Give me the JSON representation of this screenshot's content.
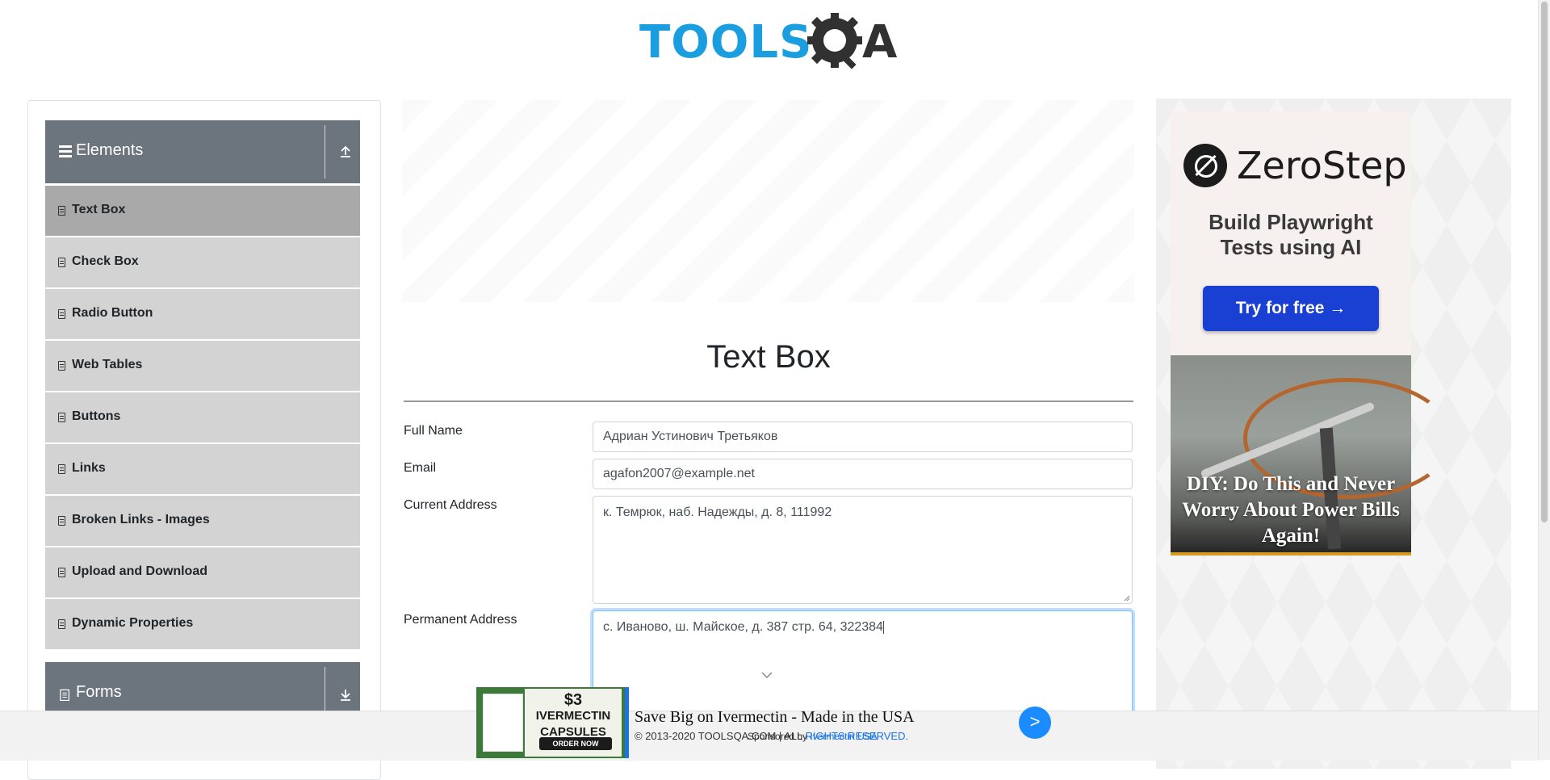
{
  "header": {
    "logo_text_left": "TOOLS",
    "logo_text_right": "A",
    "logo_icon": "gear-magnifier-icon"
  },
  "sidebar": {
    "elements_group": {
      "label": "Elements",
      "icon": "menu-icon",
      "toggle_icon": "collapse-up-icon"
    },
    "items": [
      {
        "label": "Text Box",
        "active": true
      },
      {
        "label": "Check Box"
      },
      {
        "label": "Radio Button"
      },
      {
        "label": "Web Tables"
      },
      {
        "label": "Buttons"
      },
      {
        "label": "Links"
      },
      {
        "label": "Broken Links - Images"
      },
      {
        "label": "Upload and Download"
      },
      {
        "label": "Dynamic Properties"
      }
    ],
    "forms_group": {
      "label": "Forms",
      "icon": "form-icon",
      "toggle_icon": "expand-down-icon"
    }
  },
  "main": {
    "title": "Text Box",
    "fields": {
      "full_name": {
        "label": "Full Name",
        "value": "Адриан Устинович Третьяков"
      },
      "email": {
        "label": "Email",
        "value": "agafon2007@example.net"
      },
      "current_address": {
        "label": "Current Address",
        "value": "к. Темрюк, наб. Надежды, д. 8, 111992"
      },
      "permanent_address": {
        "label": "Permanent Address",
        "value": "с. Иваново, ш. Майское, д. 387 стр. 64, 322384"
      }
    }
  },
  "right_ad": {
    "brand": "ZeroStep",
    "tagline_line1": "Build Playwright",
    "tagline_line2": "Tests using AI",
    "button": "Try for free →",
    "diy_headline": "DIY: Do This and Never Worry About Power Bills Again!"
  },
  "bottom_ad": {
    "image_price": "$3",
    "image_product": "IVERMECTIN CAPSULES",
    "image_cta": "ORDER NOW",
    "title": "Save Big on Ivermectin - Made in the USA",
    "sponsor": "Sponsored by",
    "sponsor_link": "Ivermectin USA",
    "cta": ">"
  },
  "footer": {
    "copyright": "© 2013-2020 TOOLSQA.COM | ALL",
    "rights": "RIGHTS RESERVED."
  },
  "colors": {
    "accent_blue": "#1a9ee0",
    "sidebar_header": "#6c757d",
    "menu_item_bg": "#d3d3d3",
    "menu_item_active": "#a9a9a9"
  }
}
